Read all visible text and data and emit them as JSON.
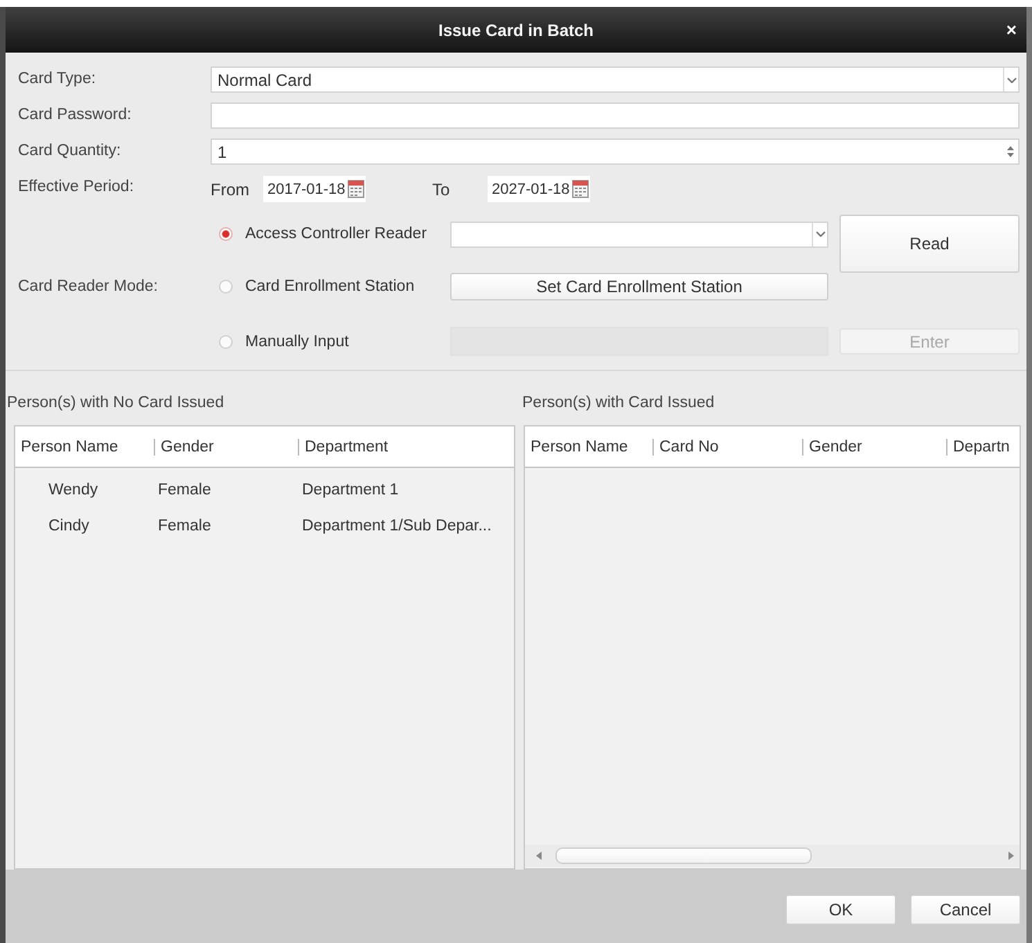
{
  "window": {
    "title": "Issue Card in Batch",
    "close": "×"
  },
  "fields": [
    {
      "kind": "dropdown",
      "label": "Card Type:",
      "value": "Normal Card"
    },
    {
      "kind": "text",
      "label": "Card Password:"
    },
    {
      "kind": "spinner",
      "label": "Card Quantity:",
      "value": "1"
    },
    {
      "kind": "period",
      "label": "Effective Period:",
      "from_label": "From",
      "from": "2017-01-18",
      "to_label": "To",
      "to": "2027-01-18"
    }
  ],
  "card_reader_mode": {
    "label": "Card Reader Mode:",
    "options": [
      {
        "kind": "dropdown",
        "label": "Access Controller Reader",
        "selected": true
      },
      {
        "kind": "button",
        "label": "Card Enrollment Station",
        "selected": false,
        "button": "Set Card Enrollment Station"
      },
      {
        "kind": "input",
        "label": "Manually Input",
        "selected": false,
        "disabled": true
      }
    ],
    "read_button": "Read",
    "enter_button": {
      "label": "Enter",
      "disabled": true
    }
  },
  "panels": [
    {
      "title": "Person(s) with No Card Issued",
      "columns": [
        "Person Name",
        "Gender",
        "Department"
      ],
      "rows": [
        [
          "Wendy",
          "Female",
          "Department 1"
        ],
        [
          "Cindy",
          "Female",
          "Department 1/Sub Depar..."
        ]
      ]
    },
    {
      "title": "Person(s) with Card Issued",
      "columns": [
        "Person Name",
        "Card No",
        "Gender",
        "Departn"
      ],
      "horizontal_scrollbar": true
    }
  ],
  "buttons": [
    "OK",
    "Cancel"
  ]
}
